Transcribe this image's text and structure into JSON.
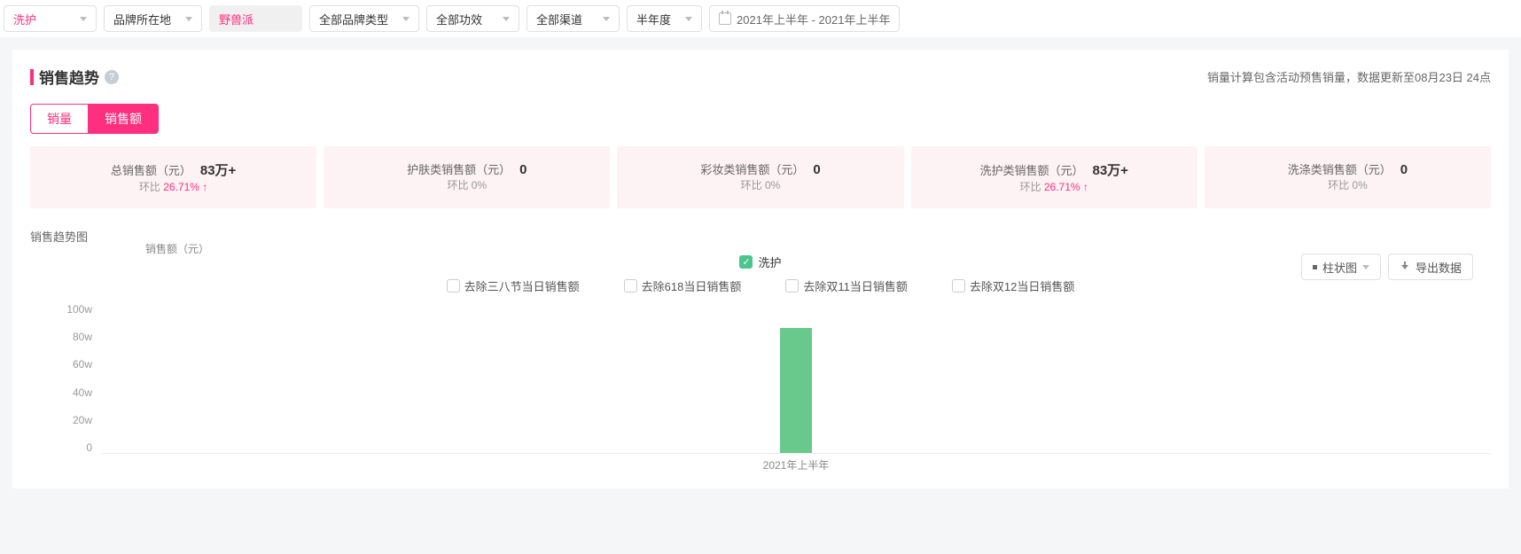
{
  "filters": {
    "category": "洗护",
    "origin": "品牌所在地",
    "brand": "野兽派",
    "brandType": "全部品牌类型",
    "efficacy": "全部功效",
    "channel": "全部渠道",
    "period": "半年度",
    "dateRange": "2021年上半年 - 2021年上半年"
  },
  "section": {
    "title": "销售趋势",
    "note": "销量计算包含活动预售销量，数据更新至08月23日 24点"
  },
  "tabs": {
    "volume": "销量",
    "amount": "销售额"
  },
  "cards": [
    {
      "label": "总销售额（元）",
      "value": "83万+",
      "hb_label": "环比",
      "hb": "26.71%",
      "up": true
    },
    {
      "label": "护肤类销售额（元）",
      "value": "0",
      "hb_label": "环比",
      "hb": "0%",
      "up": false
    },
    {
      "label": "彩妆类销售额（元）",
      "value": "0",
      "hb_label": "环比",
      "hb": "0%",
      "up": false
    },
    {
      "label": "洗护类销售额（元）",
      "value": "83万+",
      "hb_label": "环比",
      "hb": "26.71%",
      "up": true
    },
    {
      "label": "洗涤类销售额（元）",
      "value": "0",
      "hb_label": "环比",
      "hb": "0%",
      "up": false
    }
  ],
  "chartTitle": "销售趋势图",
  "legend": {
    "series": "洗护"
  },
  "checkboxes": [
    "去除三八节当日销售额",
    "去除618当日销售额",
    "去除双11当日销售额",
    "去除双12当日销售额"
  ],
  "chartType": "柱状图",
  "exportLabel": "导出数据",
  "yAxisLabel": "销售额（元）",
  "chart_data": {
    "type": "bar",
    "title": "销售趋势图",
    "categories": [
      "2021年上半年"
    ],
    "series": [
      {
        "name": "洗护",
        "values": [
          83
        ]
      }
    ],
    "ylabel": "销售额（元）",
    "ylim": [
      0,
      100
    ],
    "yticks": [
      "100w",
      "80w",
      "60w",
      "40w",
      "20w",
      "0"
    ],
    "unit": "万元"
  }
}
